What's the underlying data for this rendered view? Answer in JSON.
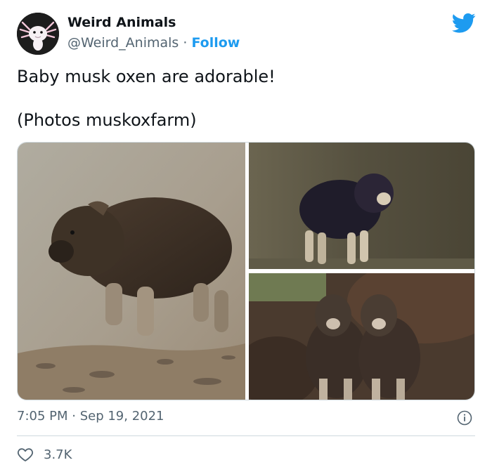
{
  "author": {
    "name": "Weird Animals",
    "handle": "@Weird_Animals",
    "separator": " · ",
    "follow_label": "Follow"
  },
  "tweet": {
    "line1": "Baby musk oxen are adorable!",
    "line2": "(Photos muskoxfarm)"
  },
  "media": {
    "count": 3,
    "photos": [
      "musk-ox-calf-walking",
      "musk-ox-calf-standing",
      "two-musk-ox-calves"
    ]
  },
  "meta": {
    "time": "7:05 PM",
    "separator": " · ",
    "date": "Sep 19, 2021"
  },
  "engagement": {
    "likes": "3.7K"
  },
  "colors": {
    "accent": "#1d9bf0",
    "text": "#0f1419",
    "muted": "#536471",
    "border": "#cfd9de"
  },
  "icons": {
    "brand": "twitter-bird-icon",
    "info": "info-icon",
    "like": "heart-icon"
  }
}
